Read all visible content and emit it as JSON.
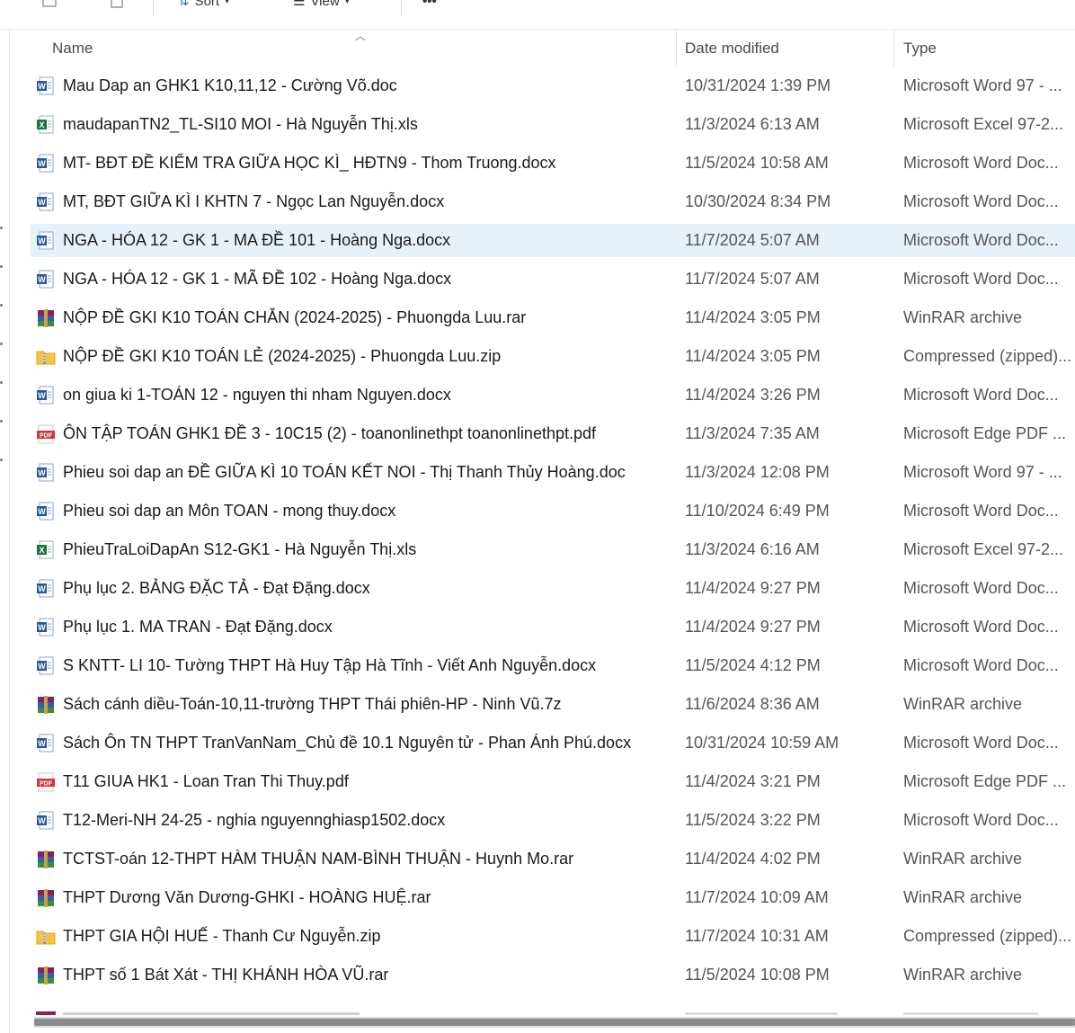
{
  "toolbar": {
    "sort_label": "Sort",
    "view_label": "View",
    "more_label": "•••"
  },
  "columns": {
    "name": "Name",
    "date": "Date modified",
    "type": "Type"
  },
  "files": [
    {
      "name": "Mau Dap an GHK1 K10,11,12 - Cường Võ.doc",
      "date": "10/31/2024 1:39 PM",
      "type": "Microsoft Word 97 - ...",
      "icon": "word"
    },
    {
      "name": "maudapanTN2_TL-SI10 MOI - Hà Nguyễn Thị.xls",
      "date": "11/3/2024 6:13 AM",
      "type": "Microsoft Excel 97-2...",
      "icon": "excel"
    },
    {
      "name": "MT- BĐT ĐỀ KIỂM TRA GIỮA HỌC KÌ_ HĐTN9 - Thom Truong.docx",
      "date": "11/5/2024 10:58 AM",
      "type": "Microsoft Word Doc...",
      "icon": "word"
    },
    {
      "name": "MT, BĐT GIỮA KÌ I KHTN 7 - Ngọc Lan Nguyễn.docx",
      "date": "10/30/2024 8:34 PM",
      "type": "Microsoft Word Doc...",
      "icon": "word"
    },
    {
      "name": "NGA - HÓA 12 - GK 1 - MA ĐỀ 101 - Hoàng Nga.docx",
      "date": "11/7/2024 5:07 AM",
      "type": "Microsoft Word Doc...",
      "icon": "word",
      "selected": true
    },
    {
      "name": "NGA - HÓA 12 - GK 1 - MÃ ĐỀ 102 - Hoàng Nga.docx",
      "date": "11/7/2024 5:07 AM",
      "type": "Microsoft Word Doc...",
      "icon": "word"
    },
    {
      "name": "NỘP ĐỀ GKI K10 TOÁN CHẴN (2024-2025) - Phuongda Luu.rar",
      "date": "11/4/2024 3:05 PM",
      "type": "WinRAR archive",
      "icon": "rar"
    },
    {
      "name": "NỘP ĐỀ GKI K10 TOÁN LẺ (2024-2025) - Phuongda Luu.zip",
      "date": "11/4/2024 3:05 PM",
      "type": "Compressed (zipped)...",
      "icon": "zip"
    },
    {
      "name": "on giua ki 1-TOÁN 12 - nguyen thi nham Nguyen.docx",
      "date": "11/4/2024 3:26 PM",
      "type": "Microsoft Word Doc...",
      "icon": "word"
    },
    {
      "name": "ÔN TẬP TOÁN GHK1 ĐỀ 3 - 10C15 (2) - toanonlinethpt toanonlinethpt.pdf",
      "date": "11/3/2024 7:35 AM",
      "type": "Microsoft Edge PDF ...",
      "icon": "pdf"
    },
    {
      "name": "Phieu soi dap an ĐỀ GIỮA KÌ 10 TOÁN KẾT NOI - Thị Thanh Thủy Hoàng.doc",
      "date": "11/3/2024 12:08 PM",
      "type": "Microsoft Word 97 - ...",
      "icon": "word"
    },
    {
      "name": "Phieu soi dap an Môn TOAN - mong thuy.docx",
      "date": "11/10/2024 6:49 PM",
      "type": "Microsoft Word Doc...",
      "icon": "word"
    },
    {
      "name": "PhieuTraLoiDapAn S12-GK1 - Hà Nguyễn Thị.xls",
      "date": "11/3/2024 6:16 AM",
      "type": "Microsoft Excel 97-2...",
      "icon": "excel"
    },
    {
      "name": "Phụ lục  2. BẢNG ĐẶC TẢ - Đạt Đặng.docx",
      "date": "11/4/2024 9:27 PM",
      "type": "Microsoft Word Doc...",
      "icon": "word"
    },
    {
      "name": "Phụ lục 1. MA TRAN - Đạt Đặng.docx",
      "date": "11/4/2024 9:27 PM",
      "type": "Microsoft Word Doc...",
      "icon": "word"
    },
    {
      "name": "S KNTT- LI 10- Tường THPT Hà Huy Tập Hà Tĩnh - Viết Anh Nguyễn.docx",
      "date": "11/5/2024 4:12 PM",
      "type": "Microsoft Word Doc...",
      "icon": "word"
    },
    {
      "name": "Sách cánh diều-Toán-10,11-trường THPT Thái phiên-HP - Ninh Vũ.7z",
      "date": "11/6/2024 8:36 AM",
      "type": "WinRAR archive",
      "icon": "rar"
    },
    {
      "name": "Sách Ôn TN THPT TranVanNam_Chủ đề 10.1 Nguyên tử - Phan Ánh Phú.docx",
      "date": "10/31/2024 10:59 AM",
      "type": "Microsoft Word Doc...",
      "icon": "word"
    },
    {
      "name": "T11 GIUA HK1  - Loan Tran Thi Thuy.pdf",
      "date": "11/4/2024 3:21 PM",
      "type": "Microsoft Edge PDF ...",
      "icon": "pdf"
    },
    {
      "name": "T12-Meri-NH 24-25 - nghia nguyennghiasp1502.docx",
      "date": "11/5/2024 3:22 PM",
      "type": "Microsoft Word Doc...",
      "icon": "word"
    },
    {
      "name": "TCTST-oán 12-THPT HÀM THUẬN NAM-BÌNH THUẬN - Huynh Mo.rar",
      "date": "11/4/2024 4:02 PM",
      "type": "WinRAR archive",
      "icon": "rar"
    },
    {
      "name": "THPT Dương Văn Dương-GHKI - HOÀNG HUỆ.rar",
      "date": "11/7/2024 10:09 AM",
      "type": "WinRAR archive",
      "icon": "rar"
    },
    {
      "name": "THPT GIA HỘI HUẾ - Thanh Cư Nguyễn.zip",
      "date": "11/7/2024 10:31 AM",
      "type": "Compressed (zipped)...",
      "icon": "zip"
    },
    {
      "name": "THPT số 1 Bát Xát - THỊ KHÁNH HÒA VŨ.rar",
      "date": "11/5/2024 10:08 PM",
      "type": "WinRAR archive",
      "icon": "rar"
    }
  ],
  "colors": {
    "selection": "#e5f1fb",
    "word": "#2b5797",
    "excel": "#1e7145",
    "pdf": "#d13438",
    "zip": "#f4c542"
  }
}
